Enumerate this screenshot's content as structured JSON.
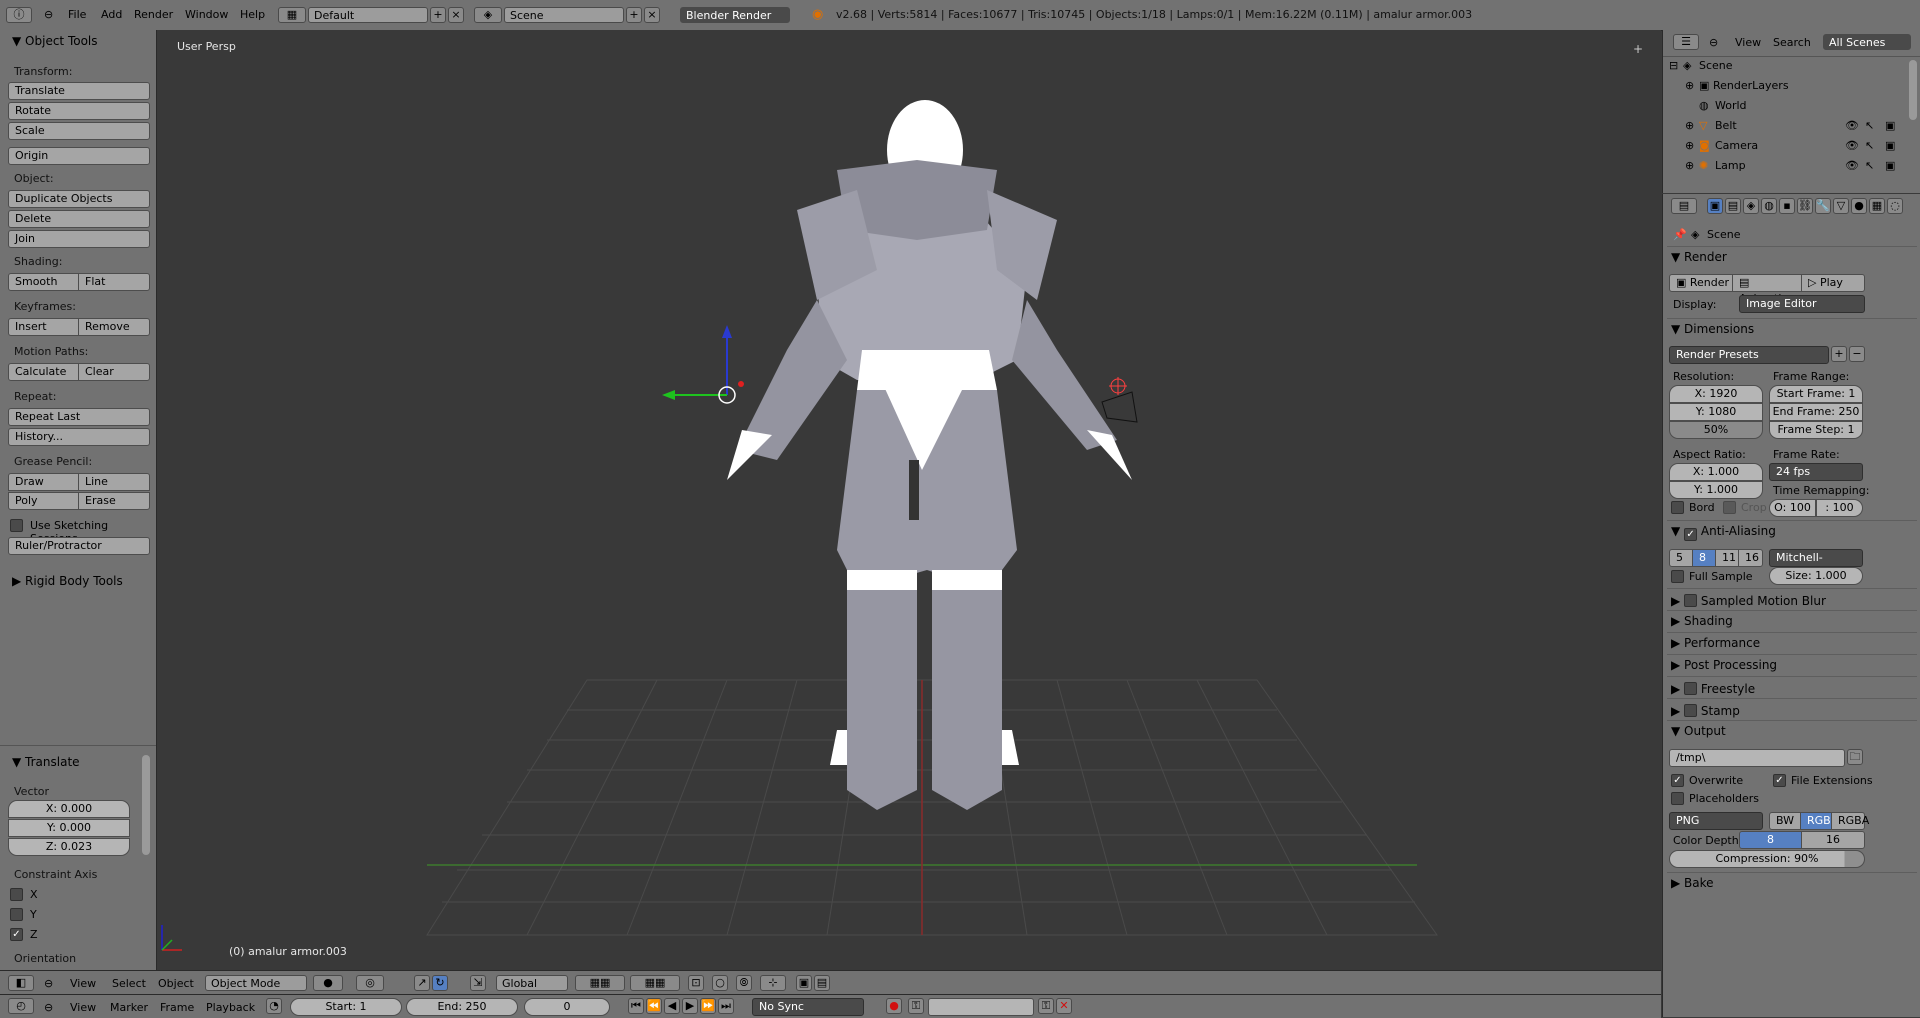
{
  "topbar": {
    "menus": [
      "File",
      "Add",
      "Render",
      "Window",
      "Help"
    ],
    "layout": "Default",
    "scene": "Scene",
    "engine": "Blender Render",
    "stats": "v2.68 | Verts:5814 | Faces:10677 | Tris:10745 | Objects:1/18 | Lamps:0/1 | Mem:16.22M (0.11M) | amalur armor.003"
  },
  "tools": {
    "title": "Object Tools",
    "transform_label": "Transform:",
    "translate": "Translate",
    "rotate": "Rotate",
    "scale": "Scale",
    "origin": "Origin",
    "object_label": "Object:",
    "duplicate": "Duplicate Objects",
    "delete": "Delete",
    "join": "Join",
    "shading_label": "Shading:",
    "smooth": "Smooth",
    "flat": "Flat",
    "keyframes_label": "Keyframes:",
    "insert": "Insert",
    "remove": "Remove",
    "motion_label": "Motion Paths:",
    "calculate": "Calculate",
    "clear": "Clear",
    "repeat_label": "Repeat:",
    "repeat_last": "Repeat Last",
    "history": "History...",
    "grease_label": "Grease Pencil:",
    "draw": "Draw",
    "line": "Line",
    "poly": "Poly",
    "erase": "Erase",
    "sketching": "Use Sketching Sessions",
    "ruler": "Ruler/Protractor",
    "rigid": "Rigid Body Tools"
  },
  "operator": {
    "title": "Translate",
    "vector_label": "Vector",
    "x": "X: 0.000",
    "y": "Y: 0.000",
    "z": "Z: 0.023",
    "constraint_label": "Constraint Axis",
    "cx": "X",
    "cy": "Y",
    "cz": "Z",
    "cz_checked": "✓",
    "orientation_label": "Orientation"
  },
  "viewport": {
    "view_label": "User Persp",
    "object_label": "(0) amalur armor.003"
  },
  "view3d_header": {
    "view": "View",
    "select": "Select",
    "object": "Object",
    "mode": "Object Mode",
    "orientation": "Global"
  },
  "timeline": {
    "view": "View",
    "marker": "Marker",
    "frame": "Frame",
    "playback": "Playback",
    "start": "Start: 1",
    "end": "End: 250",
    "current": "0",
    "sync": "No Sync"
  },
  "outliner": {
    "view": "View",
    "search": "Search",
    "filter": "All Scenes",
    "rows": [
      "Scene",
      "RenderLayers",
      "World",
      "Belt",
      "Camera",
      "Lamp"
    ]
  },
  "properties": {
    "context": "Scene",
    "render_section": "Render",
    "render_btn": "Render",
    "animation_btn": "Animation",
    "play_btn": "Play",
    "display_label": "Display:",
    "display_value": "Image Editor",
    "dimensions_section": "Dimensions",
    "presets": "Render Presets",
    "resolution_label": "Resolution:",
    "res_x": "X: 1920",
    "res_y": "Y: 1080",
    "res_pct": "50%",
    "frame_range_label": "Frame Range:",
    "start_frame": "Start Frame: 1",
    "end_frame": "End Frame: 250",
    "frame_step": "Frame Step: 1",
    "aspect_label": "Aspect Ratio:",
    "asp_x": "X: 1.000",
    "asp_y": "Y: 1.000",
    "frame_rate_label": "Frame Rate:",
    "fps": "24 fps",
    "time_remap_label": "Time Remapping:",
    "remap_old": "O: 100",
    "remap_new": ": 100",
    "bord": "Bord",
    "crop": "Crop",
    "aa_section": "Anti-Aliasing",
    "aa_samples": [
      "5",
      "8",
      "11",
      "16"
    ],
    "aa_filter": "Mitchell-Netravali",
    "full_sample": "Full Sample",
    "aa_size": "Size: 1.000",
    "collapsed": [
      "Sampled Motion Blur",
      "Shading",
      "Performance",
      "Post Processing",
      "Freestyle",
      "Stamp"
    ],
    "output_section": "Output",
    "output_path": "/tmp\\",
    "overwrite": "Overwrite",
    "file_ext": "File Extensions",
    "placeholders": "Placeholders",
    "format": "PNG",
    "bw": "BW",
    "rgb": "RGB",
    "rgba": "RGBA",
    "color_depth_label": "Color Depth:",
    "depth_8": "8",
    "depth_16": "16",
    "compression": "Compression: 90%",
    "bake_section": "Bake"
  },
  "colors": {
    "panel": "#727272",
    "viewport": "#393939",
    "accent": "#5680c2"
  }
}
